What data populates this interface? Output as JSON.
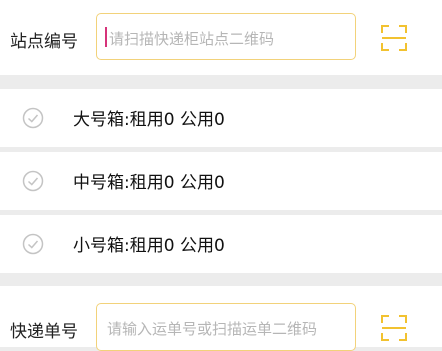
{
  "station": {
    "label": "站点编号",
    "placeholder": "请扫描快递柜站点二维码"
  },
  "boxes": [
    {
      "size": "大号箱:租用0  公用0"
    },
    {
      "size": "中号箱:租用0  公用0"
    },
    {
      "size": "小号箱:租用0  公用0"
    }
  ],
  "tracking": {
    "label": "快递单号",
    "placeholder": "请输入运单号或扫描运单二维码"
  },
  "colors": {
    "accent": "#f2c230",
    "check": "#c4c4c4"
  },
  "icons": {
    "scan": "scan-icon",
    "check": "check-circle-icon"
  }
}
